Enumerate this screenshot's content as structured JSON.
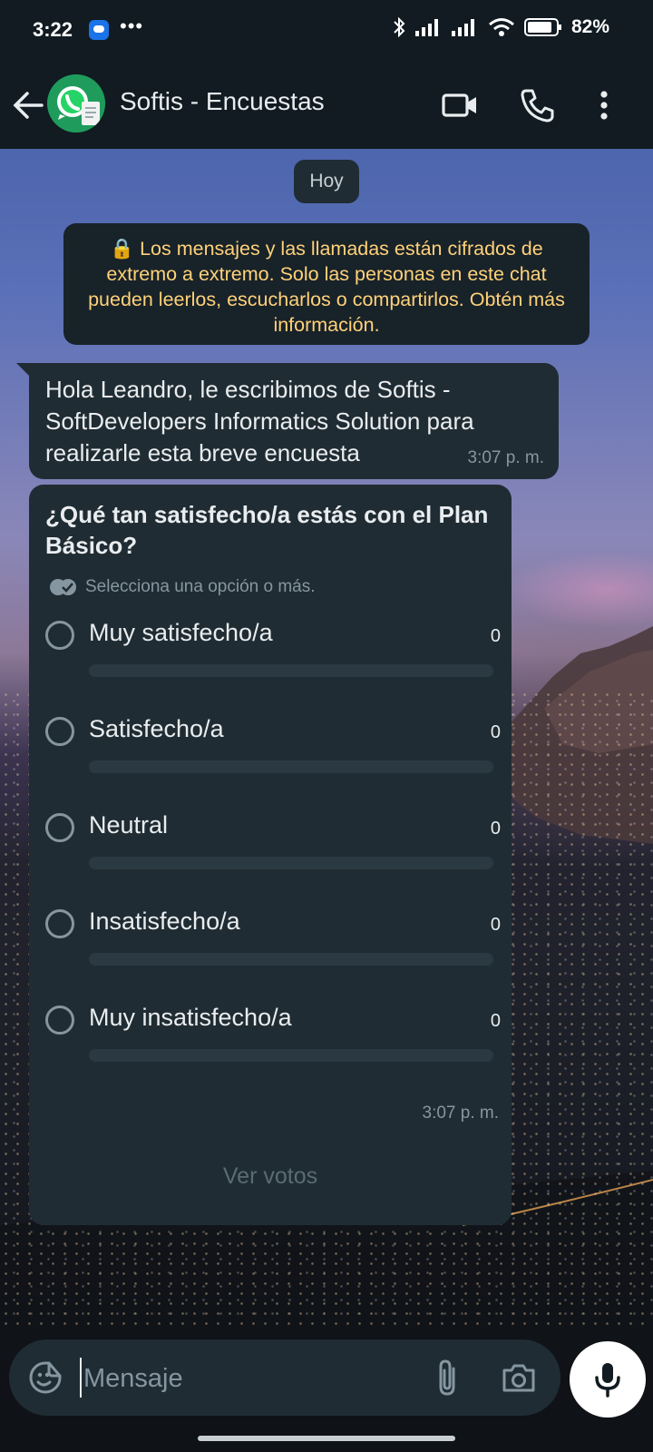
{
  "status_bar": {
    "time": "3:22",
    "dots": "•••",
    "battery": "82%"
  },
  "header": {
    "title": "Softis - Encuestas"
  },
  "chat": {
    "date_chip": "Hoy",
    "encryption_notice": "🔒 Los mensajes y las llamadas están cifrados de extremo a extremo. Solo las personas en este chat pueden leerlos, escucharlos o compartirlos. Obtén más información.",
    "message_1": {
      "text": "Hola Leandro, le escribimos de Softis - SoftDevelopers Informatics Solution para realizarle esta breve encuesta",
      "time": "3:07 p. m."
    },
    "poll": {
      "question": "¿Qué tan satisfecho/a estás con el Plan Básico?",
      "hint": "Selecciona una opción o más.",
      "options": [
        {
          "label": "Muy satisfecho/a",
          "votes": "0",
          "fraction": 0
        },
        {
          "label": "Satisfecho/a",
          "votes": "0",
          "fraction": 0
        },
        {
          "label": "Neutral",
          "votes": "0",
          "fraction": 0
        },
        {
          "label": "Insatisfecho/a",
          "votes": "0",
          "fraction": 0
        },
        {
          "label": "Muy insatisfecho/a",
          "votes": "0",
          "fraction": 0
        }
      ],
      "time": "3:07 p. m.",
      "view_votes": "Ver votos"
    }
  },
  "composer": {
    "placeholder": "Mensaje"
  },
  "colors": {
    "accent": "#00a884",
    "bubble": "#202c33",
    "header": "#111b21",
    "notice_text": "#ffd279"
  }
}
